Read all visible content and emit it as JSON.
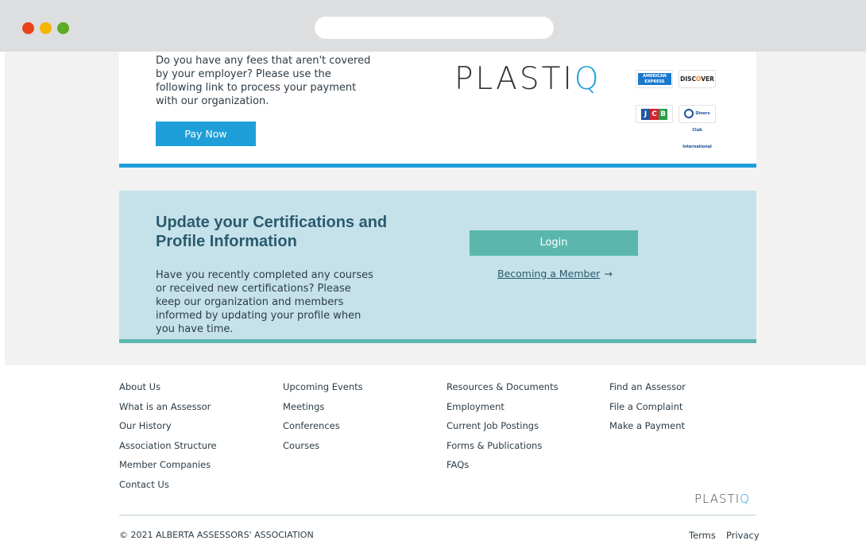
{
  "browser": {
    "window_controls": [
      "close",
      "minimize",
      "maximize"
    ],
    "url": ""
  },
  "payment_section": {
    "description": "Do you have any fees that aren't covered by your employer? Please use the following link to process your payment with our organization.",
    "pay_button_label": "Pay Now",
    "logo_text_main": "PLASTI",
    "logo_text_q": "Q",
    "card_brands": {
      "amex_line1": "AMERICAN",
      "amex_line2": "EXPRESS",
      "discover_pre": "DISC",
      "discover_o": "O",
      "discover_post": "VER",
      "jcb_j": "J",
      "jcb_c": "C",
      "jcb_b": "B",
      "diners": "Diners Club International"
    },
    "accent_color": "#1f9fd9"
  },
  "certification_section": {
    "title": "Update your Certifications and Profile Information",
    "description": "Have you recently completed any courses or received new certifications? Please keep our organization and members informed by updating your profile when you have time.",
    "login_button_label": "Login",
    "member_link_label": "Becoming a Member",
    "member_link_arrow": "→",
    "background_color": "#c5e2eb",
    "accent_color": "#5bb7ae"
  },
  "footer": {
    "columns": [
      [
        "About Us",
        "What is an Assessor",
        "Our History",
        "Association Structure",
        "Member Companies",
        "Contact Us"
      ],
      [
        "Upcoming Events",
        "Meetings",
        "Conferences",
        "Courses"
      ],
      [
        "Resources & Documents",
        "Employment",
        "Current Job Postings",
        "Forms & Publications",
        "FAQs"
      ],
      [
        "Find an Assessor",
        "File a Complaint",
        "Make a Payment"
      ]
    ],
    "logo_text_main": "PLASTI",
    "logo_text_q": "Q",
    "copyright": "© 2021 ALBERTA ASSESSORS' ASSOCIATION",
    "terms_label": "Terms",
    "privacy_label": "Privacy"
  }
}
